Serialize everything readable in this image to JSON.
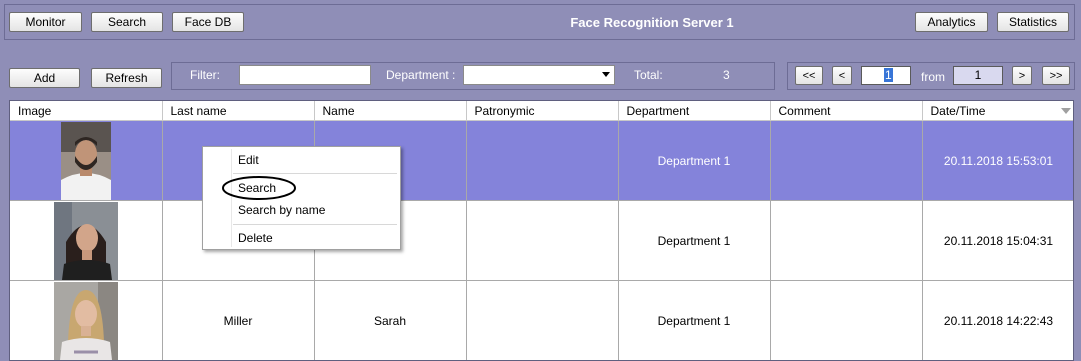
{
  "header": {
    "title": "Face Recognition Server 1",
    "left_buttons": [
      "Monitor",
      "Search",
      "Face DB"
    ],
    "right_buttons": [
      "Analytics",
      "Statistics"
    ]
  },
  "toolbar": {
    "add_label": "Add",
    "refresh_label": "Refresh",
    "filter_label": "Filter:",
    "filter_value": "",
    "department_label": "Department :",
    "department_value": "",
    "total_label": "Total:",
    "total_value": "3"
  },
  "pager": {
    "first": "<<",
    "prev": "<",
    "page": "1",
    "from_label": "from",
    "page_count": "1",
    "next": ">",
    "last": ">>"
  },
  "table": {
    "columns": [
      "Image",
      "Last name",
      "Name",
      "Patronymic",
      "Department",
      "Comment",
      "Date/Time"
    ],
    "rows": [
      {
        "last_name": "",
        "name": "",
        "patronymic": "",
        "department": "Department 1",
        "comment": "",
        "datetime": "20.11.2018 15:53:01"
      },
      {
        "last_name": "",
        "name": "",
        "patronymic": "",
        "department": "Department 1",
        "comment": "",
        "datetime": "20.11.2018 15:04:31"
      },
      {
        "last_name": "Miller",
        "name": "Sarah",
        "patronymic": "",
        "department": "Department 1",
        "comment": "",
        "datetime": "20.11.2018 14:22:43"
      }
    ]
  },
  "context_menu": {
    "items": [
      "Edit",
      "Search",
      "Search by name",
      "Delete"
    ]
  },
  "colors": {
    "background": "#8f8eb7",
    "selected_row": "#8483da",
    "highlight_circle": "#000000"
  },
  "icons": {
    "dropdown": "triangle-down",
    "sort": "triangle-down"
  }
}
